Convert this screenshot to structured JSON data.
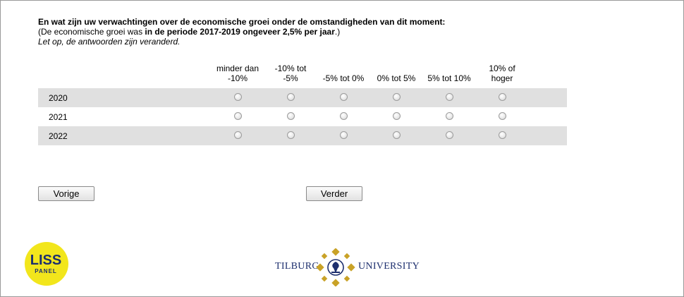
{
  "question": {
    "title": "En wat zijn uw verwachtingen over de economische groei onder de omstandigheden van dit moment:",
    "subtitle_prefix": "(De economische groei was ",
    "subtitle_bold": "in de periode 2017-2019 ongeveer 2,5% per jaar",
    "subtitle_suffix": ".)",
    "note": "Let op, de antwoorden zijn veranderd."
  },
  "grid": {
    "columns": [
      {
        "line1": "minder dan",
        "line2": "-10%"
      },
      {
        "line1": "-10% tot",
        "line2": "-5%"
      },
      {
        "line1": "",
        "line2": "-5% tot 0%"
      },
      {
        "line1": "",
        "line2": "0% tot 5%"
      },
      {
        "line1": "",
        "line2": "5% tot 10%"
      },
      {
        "line1": "10% of",
        "line2": "hoger"
      }
    ],
    "rows": [
      {
        "label": "2020"
      },
      {
        "label": "2021"
      },
      {
        "label": "2022"
      }
    ]
  },
  "buttons": {
    "previous": "Vorige",
    "next": "Verder"
  },
  "logos": {
    "liss_top": "LISS",
    "liss_bottom": "PANEL",
    "tilburg_left": "TILBURG",
    "tilburg_right": "UNIVERSITY"
  },
  "colors": {
    "row_shade": "#e0e0e0",
    "liss_yellow": "#f2e61c",
    "tilburg_navy": "#1d2f6e",
    "tilburg_gold": "#c9a227"
  }
}
